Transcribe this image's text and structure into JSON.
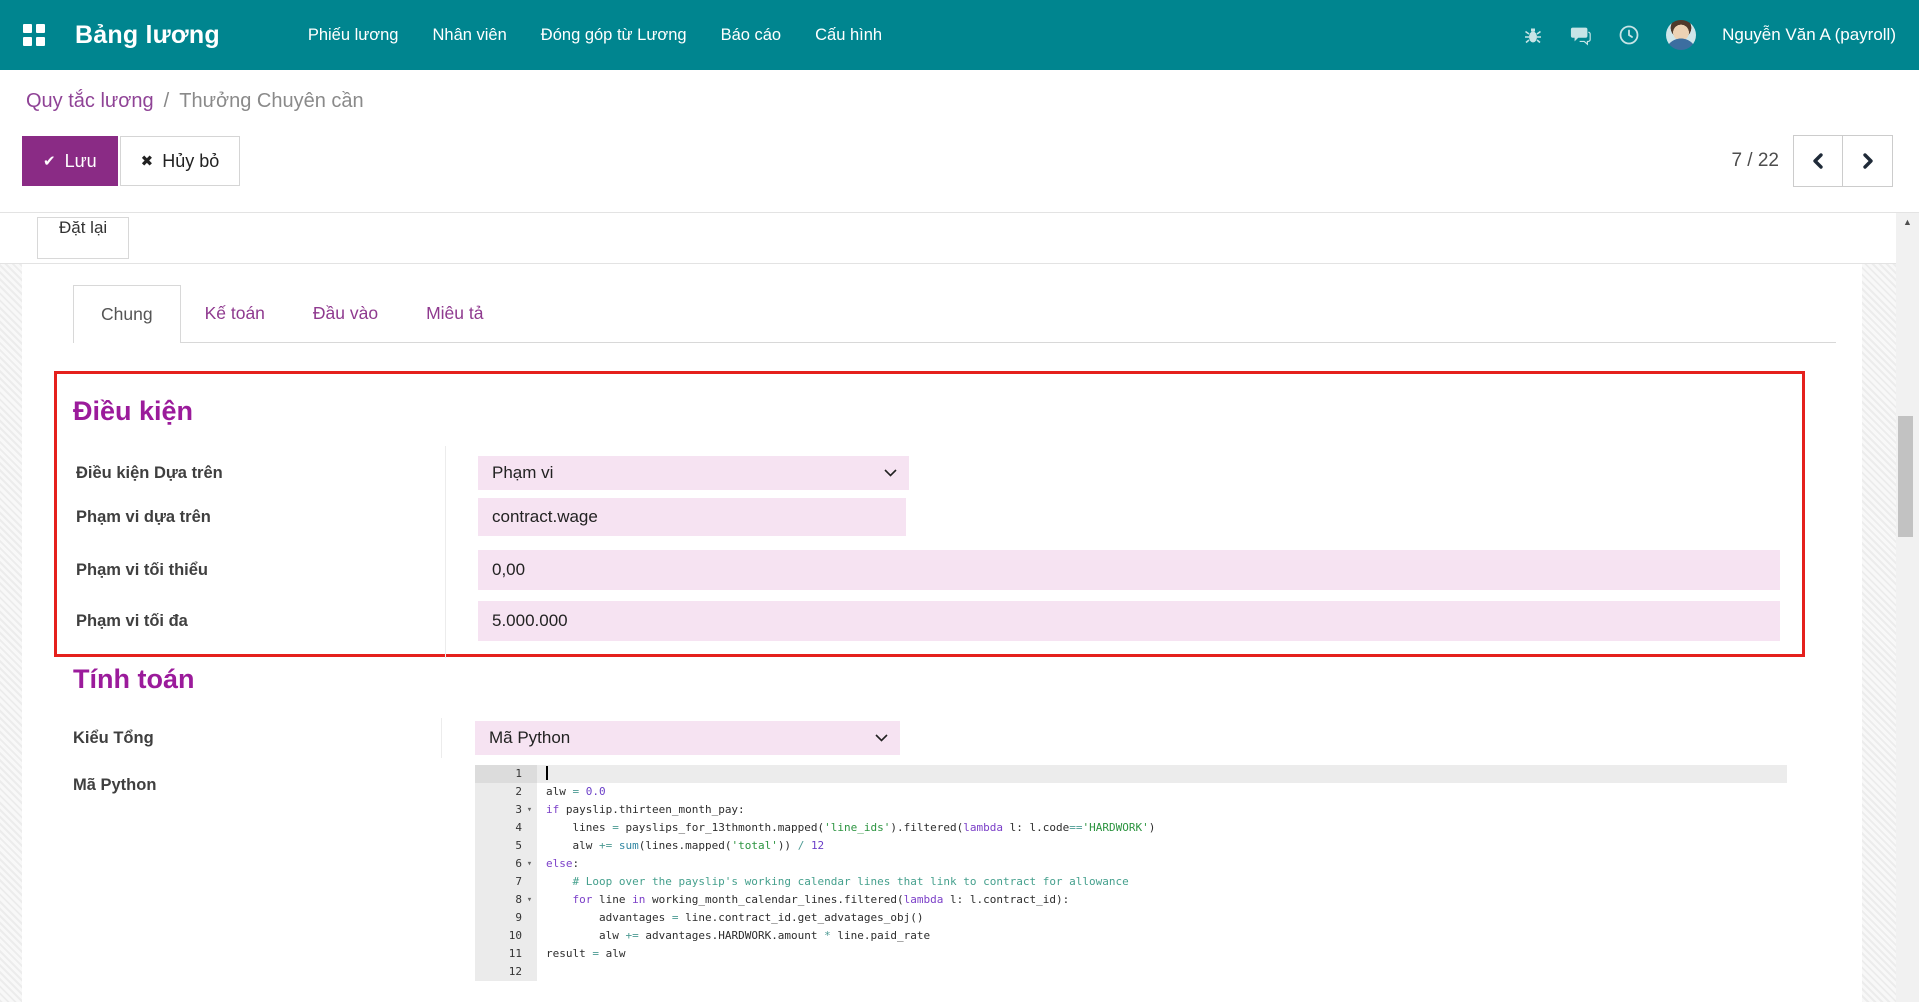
{
  "navbar": {
    "brand": "Bảng lương",
    "menu_items": [
      "Phiếu lương",
      "Nhân viên",
      "Đóng góp từ Lương",
      "Báo cáo",
      "Cấu hình"
    ],
    "icons": [
      "apps-grid-icon",
      "bug-icon",
      "chat-icon",
      "clock-icon"
    ],
    "user_name": "Nguyễn Văn A (payroll)"
  },
  "breadcrumb": {
    "parent": "Quy tắc lương",
    "separator": "/",
    "current": "Thưởng Chuyên cần"
  },
  "actions": {
    "save_label": "Lưu",
    "discard_label": "Hủy bỏ",
    "reset_label": "Đặt lại"
  },
  "pager": {
    "text": "7 / 22"
  },
  "tabs": [
    {
      "label": "Chung",
      "active": true
    },
    {
      "label": "Kế toán",
      "active": false
    },
    {
      "label": "Đầu vào",
      "active": false
    },
    {
      "label": "Miêu tả",
      "active": false
    }
  ],
  "sections": {
    "conditions": {
      "title": "Điều kiện",
      "fields": [
        {
          "label": "Điều kiện Dựa trên",
          "type": "select",
          "value": "Phạm vi"
        },
        {
          "label": "Phạm vi dựa trên",
          "type": "input",
          "value": "contract.wage"
        },
        {
          "label": "Phạm vi tối thiểu",
          "type": "input",
          "value": "0,00"
        },
        {
          "label": "Phạm vi tối đa",
          "type": "input",
          "value": "5.000.000"
        }
      ]
    },
    "computation": {
      "title": "Tính toán",
      "amount_type": {
        "label": "Kiểu Tổng",
        "type": "select",
        "value": "Mã Python"
      },
      "code_label": "Mã Python"
    }
  },
  "code_editor": {
    "lines": [
      {
        "n": "1",
        "active": true,
        "cursor": true,
        "tokens": []
      },
      {
        "n": "2",
        "tokens": [
          {
            "c": "p",
            "t": "alw "
          },
          {
            "c": "o",
            "t": "= "
          },
          {
            "c": "n",
            "t": "0.0"
          }
        ]
      },
      {
        "n": "3",
        "fold": true,
        "tokens": [
          {
            "c": "k",
            "t": "if"
          },
          {
            "c": "p",
            "t": " payslip.thirteen_month_pay:"
          }
        ]
      },
      {
        "n": "4",
        "tokens": [
          {
            "c": "p",
            "t": "    lines "
          },
          {
            "c": "o",
            "t": "= "
          },
          {
            "c": "p",
            "t": "payslips_for_13thmonth.mapped("
          },
          {
            "c": "s",
            "t": "'line_ids'"
          },
          {
            "c": "p",
            "t": ").filtered("
          },
          {
            "c": "k",
            "t": "lambda"
          },
          {
            "c": "p",
            "t": " l: l.code"
          },
          {
            "c": "o",
            "t": "=="
          },
          {
            "c": "s",
            "t": "'HARDWORK'"
          },
          {
            "c": "p",
            "t": ")"
          }
        ]
      },
      {
        "n": "5",
        "tokens": [
          {
            "c": "p",
            "t": "    alw "
          },
          {
            "c": "o",
            "t": "+= "
          },
          {
            "c": "b",
            "t": "sum"
          },
          {
            "c": "p",
            "t": "(lines.mapped("
          },
          {
            "c": "s",
            "t": "'total'"
          },
          {
            "c": "p",
            "t": ")) "
          },
          {
            "c": "o",
            "t": "/ "
          },
          {
            "c": "n",
            "t": "12"
          }
        ]
      },
      {
        "n": "6",
        "fold": true,
        "tokens": [
          {
            "c": "k",
            "t": "else"
          },
          {
            "c": "p",
            "t": ":"
          }
        ]
      },
      {
        "n": "7",
        "tokens": [
          {
            "c": "cm",
            "t": "    # Loop over the payslip's working calendar lines that link to contract for allowance"
          }
        ]
      },
      {
        "n": "8",
        "fold": true,
        "tokens": [
          {
            "c": "p",
            "t": "    "
          },
          {
            "c": "k",
            "t": "for"
          },
          {
            "c": "p",
            "t": " line "
          },
          {
            "c": "k",
            "t": "in"
          },
          {
            "c": "p",
            "t": " working_month_calendar_lines.filtered("
          },
          {
            "c": "k",
            "t": "lambda"
          },
          {
            "c": "p",
            "t": " l: l.contract_id):"
          }
        ]
      },
      {
        "n": "9",
        "tokens": [
          {
            "c": "p",
            "t": "        advantages "
          },
          {
            "c": "o",
            "t": "= "
          },
          {
            "c": "p",
            "t": "line.contract_id.get_advatages_obj()"
          }
        ]
      },
      {
        "n": "10",
        "tokens": [
          {
            "c": "p",
            "t": "        alw "
          },
          {
            "c": "o",
            "t": "+= "
          },
          {
            "c": "p",
            "t": "advantages.HARDWORK.amount "
          },
          {
            "c": "o",
            "t": "* "
          },
          {
            "c": "p",
            "t": "line.paid_rate"
          }
        ]
      },
      {
        "n": "11",
        "tokens": [
          {
            "c": "p",
            "t": "result "
          },
          {
            "c": "o",
            "t": "= "
          },
          {
            "c": "p",
            "t": "alw"
          }
        ]
      },
      {
        "n": "12",
        "tokens": []
      }
    ]
  },
  "colors": {
    "navbar_bg": "#00858f",
    "primary_purple": "#8a2b85",
    "heading_purple": "#9b1b9b",
    "breadcrumb_link_purple": "#8f4396",
    "field_bg_pink": "#f6e3f2",
    "highlight_border_red": "#e5201d",
    "code_keyword": "#7b3fc8",
    "code_string": "#2c9440",
    "code_number": "#6b3fc8",
    "code_comment": "#45a08d",
    "code_operator": "#4c9a93",
    "code_builtin": "#3187a2"
  }
}
